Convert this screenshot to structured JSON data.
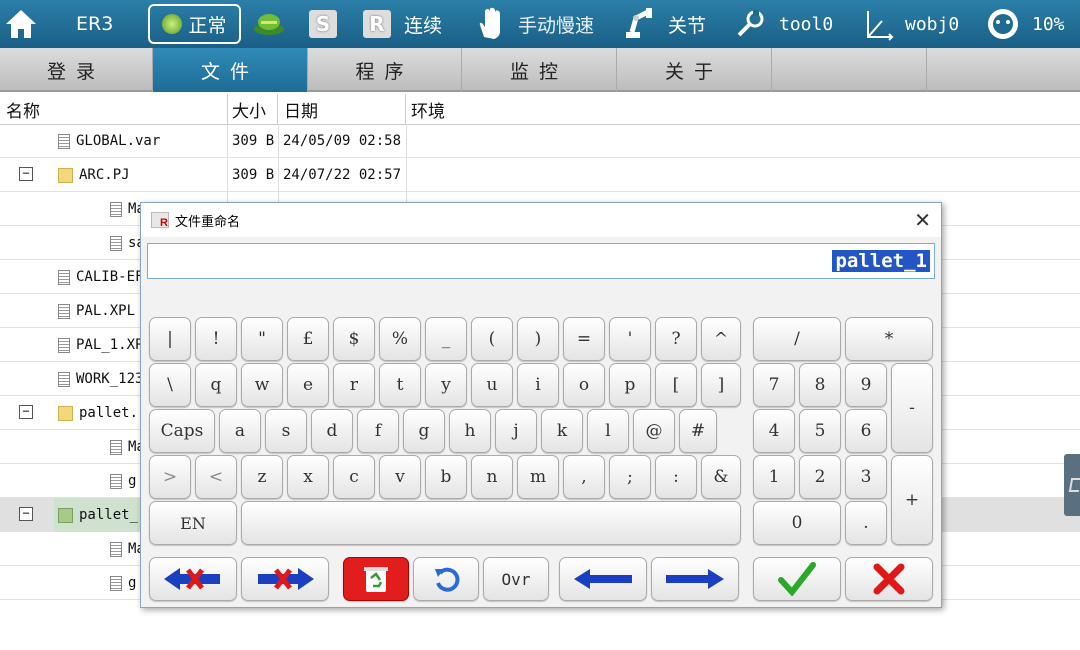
{
  "topbar": {
    "robot_name": "ER3",
    "status": "正常",
    "mode_s": "S",
    "mode_r": "R",
    "run_mode": "连续",
    "speed_mode": "手动慢速",
    "coord_mode": "关节",
    "tool": "tool0",
    "wobj": "wobj0",
    "speed_pct": "10%"
  },
  "nav": {
    "tabs": [
      {
        "label": "登录"
      },
      {
        "label": "文件"
      },
      {
        "label": "程序"
      },
      {
        "label": "监控"
      },
      {
        "label": "关于"
      }
    ]
  },
  "table": {
    "headers": {
      "name": "名称",
      "size": "大小",
      "date": "日期",
      "env": "环境"
    },
    "rows": [
      {
        "name": "GLOBAL.var",
        "size": "309 B",
        "date": "24/05/09 02:58"
      },
      {
        "name": "ARC.PJ",
        "size": "309 B",
        "date": "24/07/22 02:57"
      },
      {
        "name": "Ma"
      },
      {
        "name": "sa"
      },
      {
        "name": "CALIB-EF"
      },
      {
        "name": "PAL.XPL"
      },
      {
        "name": "PAL_1.XP"
      },
      {
        "name": "WORK_123"
      },
      {
        "name": "pallet."
      },
      {
        "name": "Ma"
      },
      {
        "name": "g"
      },
      {
        "name": "pallet_"
      },
      {
        "name": "Ma"
      },
      {
        "name": "g"
      }
    ]
  },
  "dialog": {
    "title": "文件重命名",
    "value": "pallet_1",
    "keys": {
      "r1": [
        "|",
        "!",
        "\"",
        "£",
        "$",
        "%",
        "_",
        "(",
        ")",
        "=",
        "'",
        "?",
        "^"
      ],
      "r2": [
        "\\",
        "q",
        "w",
        "e",
        "r",
        "t",
        "y",
        "u",
        "i",
        "o",
        "p",
        "[",
        "]"
      ],
      "r3": [
        "Caps",
        "a",
        "s",
        "d",
        "f",
        "g",
        "h",
        "j",
        "k",
        "l",
        "@",
        "#"
      ],
      "r4": [
        ">",
        "<",
        "z",
        "x",
        "c",
        "v",
        "b",
        "n",
        "m",
        ",",
        ";",
        ":",
        "&"
      ],
      "en": "EN",
      "ovr": "Ovr",
      "numpad": [
        "/",
        "*",
        "7",
        "8",
        "9",
        "-",
        "4",
        "5",
        "6",
        "1",
        "2",
        "3",
        "+",
        "0",
        "."
      ]
    }
  }
}
